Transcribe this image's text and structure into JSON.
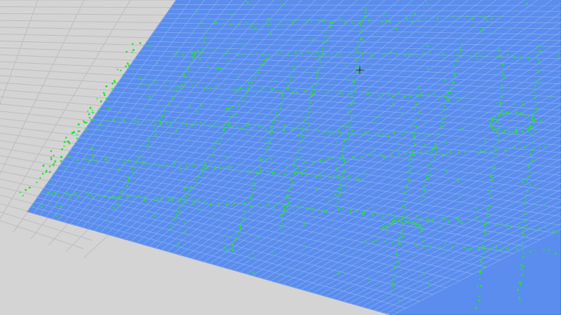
{
  "viewport": {
    "background_color": "#d4d4d4",
    "ground_grid_color": "#bdbdbd",
    "plane_color": "#5a8ded",
    "plane_edge_color": "#4a7ee0",
    "plane_grid_color": "#8cb2f5",
    "point_color": "#21e62b"
  },
  "plane": {
    "grid_visible": true
  },
  "point_cloud": {
    "visible": true,
    "marker_shape": "dot"
  },
  "view_gizmo": {
    "icon": "origin-marker-icon",
    "visible": true
  }
}
